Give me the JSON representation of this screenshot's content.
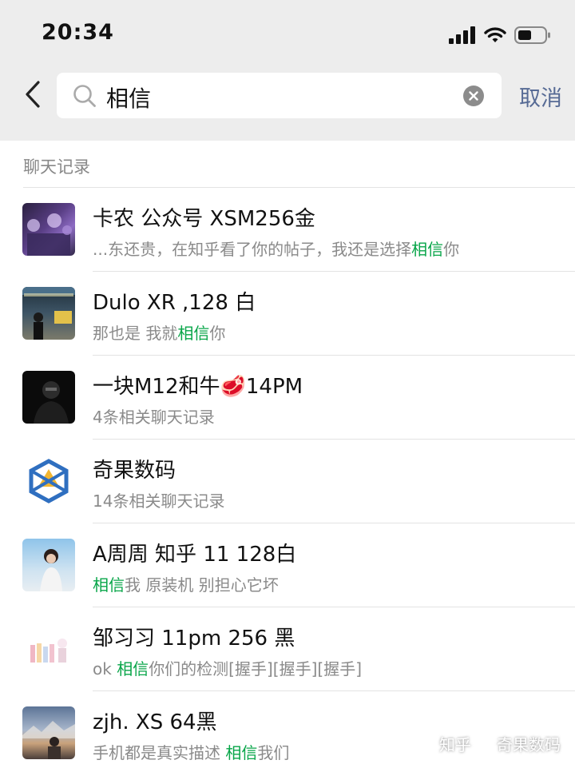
{
  "status_bar": {
    "time": "20:34",
    "icons": [
      "signal-icon",
      "wifi-icon",
      "battery-icon"
    ]
  },
  "search": {
    "query": "相信",
    "cancel_label": "取消"
  },
  "section": {
    "title": "聊天记录"
  },
  "results": [
    {
      "name": "卡农 公众号 XSM256金",
      "pre": "...东还贵，在知乎看了你的帖子，我还是选择",
      "hl": "相信",
      "post": "你",
      "avatar_colors": [
        "#3a2a52",
        "#7b5fa8"
      ]
    },
    {
      "name": "Dulo XR ,128 白",
      "pre": "那也是 我就",
      "hl": "相信",
      "post": "你",
      "avatar_colors": [
        "#2c3a44",
        "#c8a84a"
      ]
    },
    {
      "name": "一块M12和牛🥩14PM",
      "pre": "4条相关聊天记录",
      "hl": "",
      "post": "",
      "avatar_colors": [
        "#0c0c0c",
        "#3a3a3a"
      ]
    },
    {
      "name": "奇果数码",
      "pre": "14条相关聊天记录",
      "hl": "",
      "post": "",
      "avatar_colors": [
        "#ffffff",
        "#2f6fc0"
      ]
    },
    {
      "name": "A周周 知乎 11 128白",
      "pre": "",
      "hl": "相信",
      "post": "我 原装机 别担心它坏",
      "avatar_colors": [
        "#7fb5e0",
        "#d6e6f2"
      ]
    },
    {
      "name": "邹习习 11pm 256 黑",
      "pre": "ok ",
      "hl": "相信",
      "post": "你们的检测[握手][握手][握手]",
      "avatar_colors": [
        "#ffffff",
        "#e4c9d4"
      ]
    },
    {
      "name": "zjh. XS 64黑",
      "pre": "手机都是真实描述 ",
      "hl": "相信",
      "post": "我们",
      "avatar_colors": [
        "#6f86a6",
        "#b9a089"
      ]
    }
  ],
  "watermark": {
    "left": "知乎",
    "right": "奇果数码"
  },
  "colors": {
    "highlight": "#07a548",
    "link": "#576b95",
    "header_bg": "#ededed"
  }
}
